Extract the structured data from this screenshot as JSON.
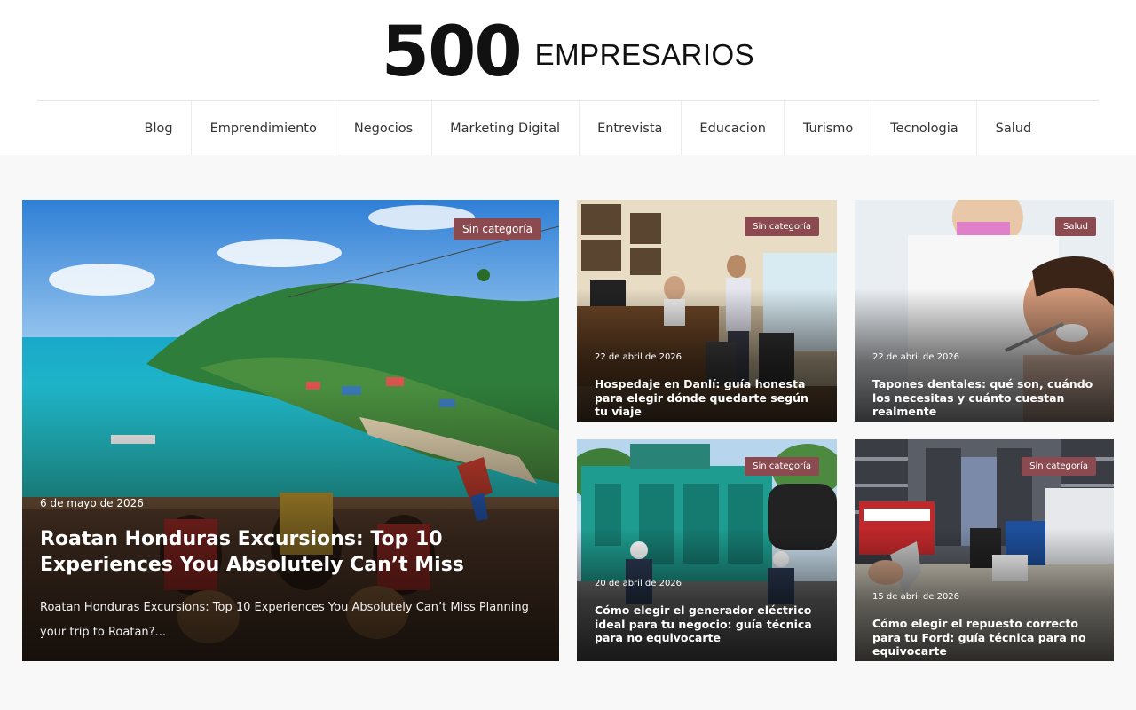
{
  "site": {
    "logo_number": "500",
    "logo_word": "EMPRESARIOS"
  },
  "nav": {
    "items": [
      {
        "label": "Blog"
      },
      {
        "label": "Emprendimiento"
      },
      {
        "label": "Negocios"
      },
      {
        "label": "Marketing Digital"
      },
      {
        "label": "Entrevista"
      },
      {
        "label": "Educacion"
      },
      {
        "label": "Turismo"
      },
      {
        "label": "Tecnologia"
      },
      {
        "label": "Salud"
      }
    ]
  },
  "featured": {
    "category": "Sin categoría",
    "date": "6 de mayo de 2026",
    "title": "Roatan Honduras Excursions: Top 10 Experiences You Absolutely Can’t Miss",
    "excerpt": "Roatan Honduras Excursions: Top 10 Experiences You Absolutely Can’t Miss Planning your trip to Roatan?..."
  },
  "posts": [
    {
      "category": "Sin categoría",
      "date": "22 de abril de 2026",
      "title": "Hospedaje en Danlí: guía honesta para elegir dónde quedarte según tu viaje"
    },
    {
      "category": "Salud",
      "date": "22 de abril de 2026",
      "title": "Tapones dentales: qué son, cuándo los necesitas y cuánto cuestan realmente"
    },
    {
      "category": "Sin categoría",
      "date": "20 de abril de 2026",
      "title": "Cómo elegir el generador eléctrico ideal para tu negocio: guía técnica para no equivocarte"
    },
    {
      "category": "Sin categoría",
      "date": "15 de abril de 2026",
      "title": "Cómo elegir el repuesto correcto para tu Ford: guía técnica para no equivocarte"
    }
  ],
  "colors": {
    "badge": "#8b4a4f",
    "background": "#f8f8f8",
    "header": "#ffffff"
  }
}
